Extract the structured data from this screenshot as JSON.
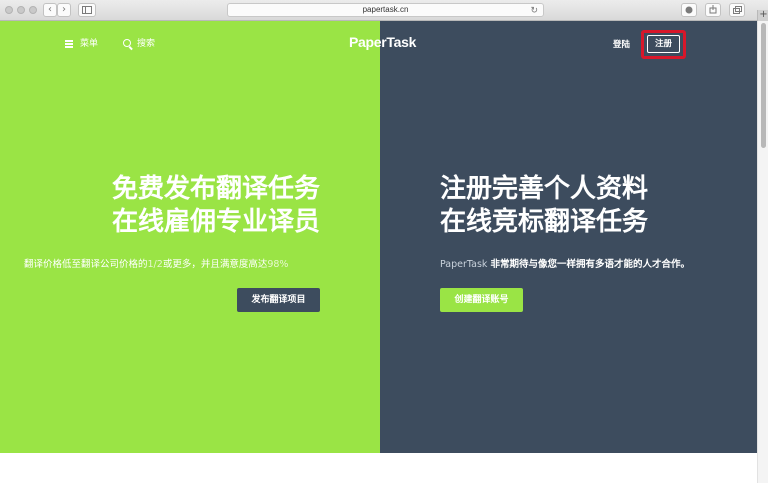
{
  "browser": {
    "url": "papertask.cn",
    "back_glyph": "‹",
    "forward_glyph": "›",
    "reload_glyph": "↻",
    "newtab_glyph": "+"
  },
  "nav": {
    "menu_label": "菜单",
    "search_label": "搜索",
    "logo": "PaperTask",
    "login_label": "登陆",
    "register_label": "注册"
  },
  "left": {
    "headline_line1": "免费发布翻译任务",
    "headline_line2": "在线雇佣专业译员",
    "subtitle_part1": "翻译价格低至翻译公司价格的",
    "subtitle_part2": "1/2",
    "subtitle_part3": "或更多，并且满意度高达",
    "subtitle_part4": "98%",
    "cta_label": "发布翻译项目"
  },
  "right": {
    "headline_line1": "注册完善个人资料",
    "headline_line2": "在线竞标翻译任务",
    "subtitle_brand": "PaperTask ",
    "subtitle_text": "非常期待与像您一样拥有多语才能的人才合作。",
    "cta_label": "创建翻译账号"
  },
  "colors": {
    "green": "#9ae445",
    "slate": "#3d4c5e",
    "highlight": "#d8172a"
  }
}
